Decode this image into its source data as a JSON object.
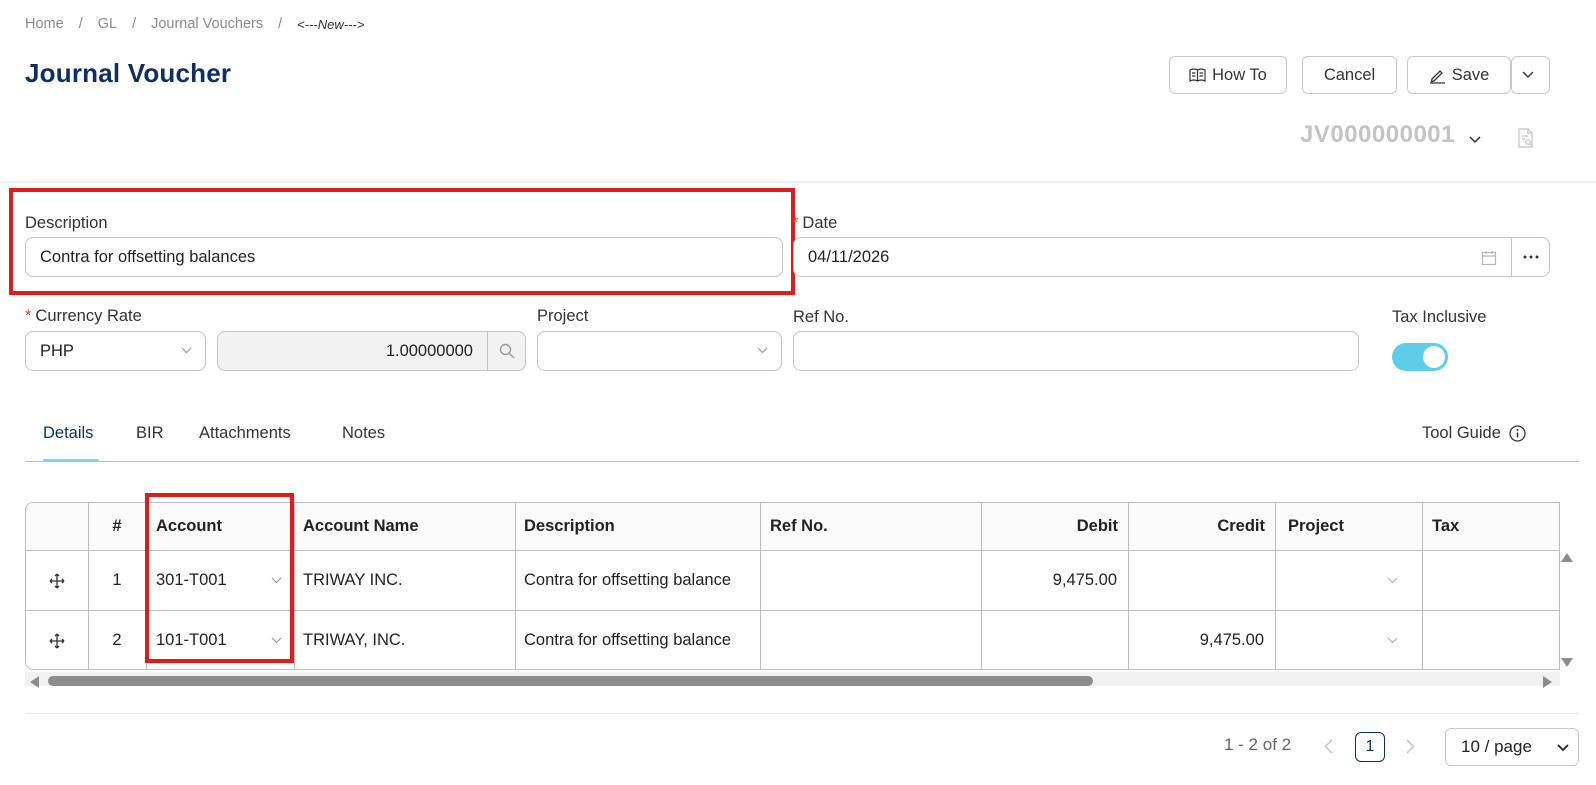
{
  "breadcrumb": {
    "items": [
      "Home",
      "GL",
      "Journal Vouchers"
    ],
    "current": "<---New--->"
  },
  "page": {
    "title": "Journal Voucher",
    "doc_no": "JV000000001"
  },
  "toolbar": {
    "how_to": "How To",
    "cancel": "Cancel",
    "save": "Save"
  },
  "form": {
    "description_label": "Description",
    "description_value": "Contra for offsetting balances",
    "date_label": "Date",
    "date_value": "04/11/2026",
    "currency_rate_label": "Currency Rate",
    "currency_value": "PHP",
    "rate_value": "1.00000000",
    "project_label": "Project",
    "ref_no_label": "Ref No.",
    "tax_inclusive_label": "Tax Inclusive",
    "tax_inclusive_on": true
  },
  "tabs": {
    "items": [
      "Details",
      "BIR",
      "Attachments",
      "Notes"
    ],
    "active": "Details",
    "tool_guide": "Tool Guide"
  },
  "grid": {
    "columns": [
      "#",
      "Account",
      "Account Name",
      "Description",
      "Ref No.",
      "Debit",
      "Credit",
      "Project",
      "Tax"
    ],
    "rows": [
      {
        "num": "1",
        "account": "301-T001",
        "account_name": "TRIWAY INC.",
        "description": "Contra for offsetting balance",
        "ref_no": "",
        "debit": "9,475.00",
        "credit": "",
        "project": "",
        "tax": ""
      },
      {
        "num": "2",
        "account": "101-T001",
        "account_name": "TRIWAY, INC.",
        "description": "Contra for offsetting balance",
        "ref_no": "",
        "debit": "",
        "credit": "9,475.00",
        "project": "",
        "tax": ""
      }
    ]
  },
  "pagination": {
    "range_text": "1 - 2 of 2",
    "current_page": "1",
    "page_size": "10 / page"
  },
  "colors": {
    "title": "#0f2f63",
    "accent": "#5ecdea",
    "highlight": "#dd1c1c",
    "required": "#e23b3b"
  }
}
